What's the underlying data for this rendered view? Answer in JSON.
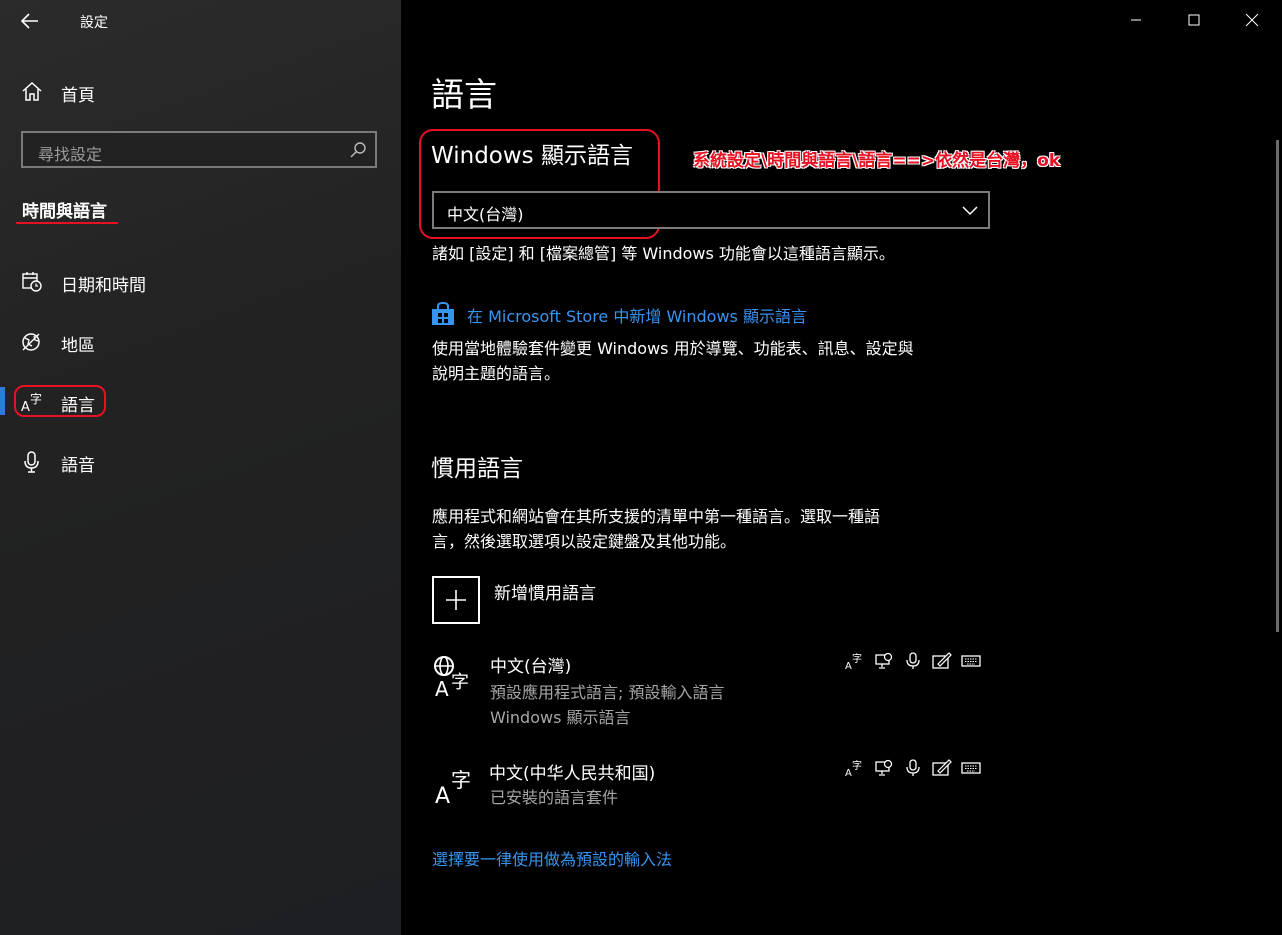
{
  "window": {
    "app_title": "設定",
    "controls": [
      "minimize-icon",
      "maximize-icon",
      "close-icon"
    ]
  },
  "sidebar": {
    "home_label": "首頁",
    "search_placeholder": "尋找設定",
    "section_title": "時間與語言",
    "items": [
      {
        "label": "日期和時間",
        "icon": "calendar-clock-icon",
        "selected": false
      },
      {
        "label": "地區",
        "icon": "region-globe-icon",
        "selected": false
      },
      {
        "label": "語言",
        "icon": "language-icon",
        "selected": true
      },
      {
        "label": "語音",
        "icon": "microphone-icon",
        "selected": false
      }
    ]
  },
  "main": {
    "page_title": "語言",
    "display_language": {
      "heading": "Windows 顯示語言",
      "selected_value": "中文(台灣)",
      "description": "諸如 [設定] 和 [檔案總管] 等 Windows 功能會以這種語言顯示。",
      "store_link": "在 Microsoft Store 中新增 Windows 顯示語言",
      "store_desc_line1": "使用當地體驗套件變更 Windows 用於導覽、功能表、訊息、設定與",
      "store_desc_line2": "說明主題的語言。"
    },
    "annotation": "系統設定\\時間與語言\\語言==>依然是台灣，ok",
    "preferred": {
      "heading": "慣用語言",
      "desc_line1": "應用程式和網站會在其所支援的清單中第一種語言。選取一種語",
      "desc_line2": "言，然後選取選項以設定鍵盤及其他功能。",
      "add_label": "新增慣用語言",
      "languages": [
        {
          "name": "中文(台灣)",
          "sub1": "預設應用程式語言; 預設輸入語言",
          "sub2": "Windows 顯示語言"
        },
        {
          "name": "中文(中华人民共和国)",
          "sub1": "已安裝的語言套件",
          "sub2": ""
        }
      ],
      "feature_icons": [
        "display-language-icon",
        "speech-recognition-icon",
        "microphone-icon",
        "handwriting-icon",
        "keyboard-icon"
      ]
    },
    "input_method_link": "選擇要一律使用做為預設的輸入法"
  },
  "colors": {
    "accent": "#3794f0",
    "annotation_red": "#e81123",
    "selected_bar": "#2f7cd6"
  }
}
